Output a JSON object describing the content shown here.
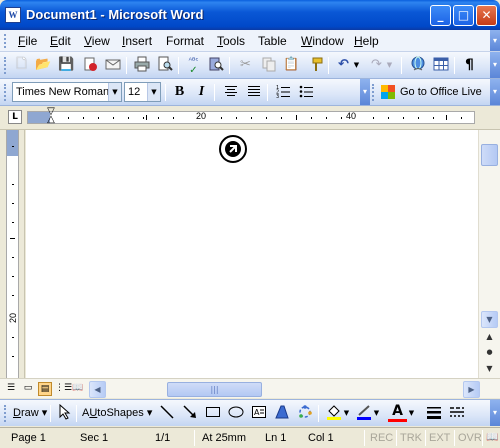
{
  "window": {
    "title": "Document1 - Microsoft Word",
    "app_icon": "W",
    "buttons": {
      "minimize": "_",
      "maximize": "□",
      "close": "✕"
    }
  },
  "menubar": {
    "items": [
      {
        "mnemonic": "F",
        "rest": "ile"
      },
      {
        "mnemonic": "E",
        "rest": "dit"
      },
      {
        "mnemonic": "V",
        "rest": "iew"
      },
      {
        "mnemonic": "I",
        "rest": "nsert"
      },
      {
        "mnemonic": "",
        "rest": "Format"
      },
      {
        "mnemonic": "T",
        "rest": "ools"
      },
      {
        "mnemonic": "",
        "rest": "Table"
      },
      {
        "mnemonic": "W",
        "rest": "indow"
      },
      {
        "mnemonic": "H",
        "rest": "elp"
      }
    ]
  },
  "standard_toolbar": {
    "icons": [
      "new-icon",
      "open-icon",
      "save-icon",
      "permission-icon",
      "email-icon",
      "print-icon",
      "print-preview-icon",
      "spelling-icon",
      "research-icon",
      "cut-icon",
      "copy-icon",
      "paste-icon",
      "format-painter-icon",
      "undo-icon",
      "redo-icon",
      "hyperlink-icon",
      "table-icon",
      "show-formatting-icon"
    ],
    "glyphs": {
      "new": "🗋",
      "open": "📂",
      "save": "💾",
      "undo": "↶",
      "redo": "↷",
      "show_formatting": "¶",
      "spelling": "ᴬᴮᶜ",
      "cut": "✂",
      "paste": "📋"
    }
  },
  "formatting_toolbar": {
    "font_name": "Times New Roman",
    "font_size": "12",
    "bold": "B",
    "italic": "I",
    "office_live": "Go to Office Live"
  },
  "ruler": {
    "tab_selector": "L",
    "labels": [
      "20",
      "40"
    ],
    "vertical_label": "20"
  },
  "scroll": {
    "up": "▲",
    "down": "▼",
    "left": "◀",
    "right": "▶",
    "prev_page": "▲",
    "select_browse": "●",
    "next_page": "▼"
  },
  "drawing_toolbar": {
    "draw_mnemonic": "D",
    "draw_rest": "raw",
    "autoshapes_mnemonic": "U",
    "autoshapes_before": "A",
    "autoshapes_rest": "toShapes",
    "icons": [
      "select-objects-icon",
      "line-icon",
      "arrow-icon",
      "rectangle-icon",
      "oval-icon",
      "text-box-icon",
      "wordart-icon",
      "diagram-icon",
      "fill-color-icon",
      "line-color-icon",
      "font-color-icon",
      "line-style-icon",
      "dash-style-icon"
    ],
    "font_color_letter": "A",
    "colors": {
      "fill": "#ffff00",
      "line": "#0000ff",
      "font": "#ff0000"
    }
  },
  "statusbar": {
    "page": "Page 1",
    "section": "Sec 1",
    "page_count": "1/1",
    "at": "At 25mm",
    "line": "Ln 1",
    "column": "Col 1",
    "rec": "REC",
    "trk": "TRK",
    "ext": "EXT",
    "ovr": "OVR"
  }
}
